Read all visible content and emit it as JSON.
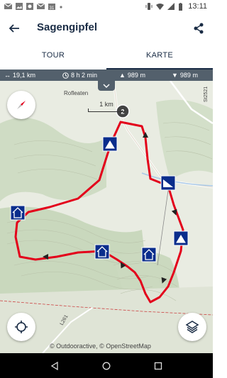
{
  "status_bar": {
    "time": "13:11",
    "left_icons": [
      "gmail-icon",
      "image-icon",
      "photo-icon",
      "gmail-icon",
      "calendar-icon",
      "dot-icon"
    ],
    "right_icons": [
      "vibrate-icon",
      "wifi-icon",
      "signal-icon",
      "battery-icon"
    ]
  },
  "app_bar": {
    "title": "Sagengipfel",
    "back_icon": "arrow-left-icon",
    "share_icon": "share-icon"
  },
  "tabs": [
    {
      "label": "TOUR",
      "active": false
    },
    {
      "label": "KARTE",
      "active": true
    }
  ],
  "stats": {
    "distance": "19,1 km",
    "duration": "8 h 2 min",
    "ascent": "989 m",
    "descent": "989 m"
  },
  "map": {
    "scale_label": "1 km",
    "place_labels": [
      "Rofleaten",
      "St2521",
      "L261"
    ],
    "route_color": "#e3001b",
    "marker_color": "#0a2d8c",
    "start_marker": "2",
    "attribution": "© Outdooractive, © OpenStreetMap"
  },
  "colors": {
    "header_text": "#1a2c45",
    "stats_bar": "#53606c"
  }
}
